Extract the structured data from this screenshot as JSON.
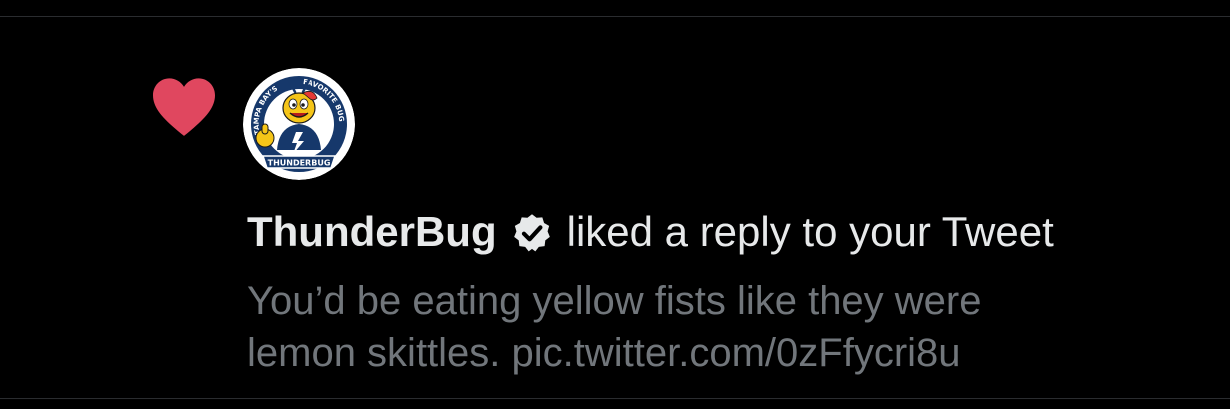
{
  "notification": {
    "user_name": "ThunderBug",
    "action_text": "liked a reply to your Tweet",
    "tweet_line_1": "You’d be eating yellow fists like they were",
    "tweet_line_2": "lemon skittles. pic.twitter.com/0zFfycri8u"
  },
  "avatar": {
    "ring_text_left": "TAMPA BAY'S",
    "ring_text_right": "FAVORITE BUG",
    "badge_text": "THUNDERBUG"
  },
  "icons": {
    "like": "heart-icon",
    "verified": "verified-badge-icon"
  },
  "colors": {
    "background": "#000000",
    "heart": "#e0475f",
    "primary_text": "#e7e9ea",
    "secondary_text": "#71767b",
    "avatar_ring": "#16386b",
    "divider": "#2a2c2f"
  }
}
